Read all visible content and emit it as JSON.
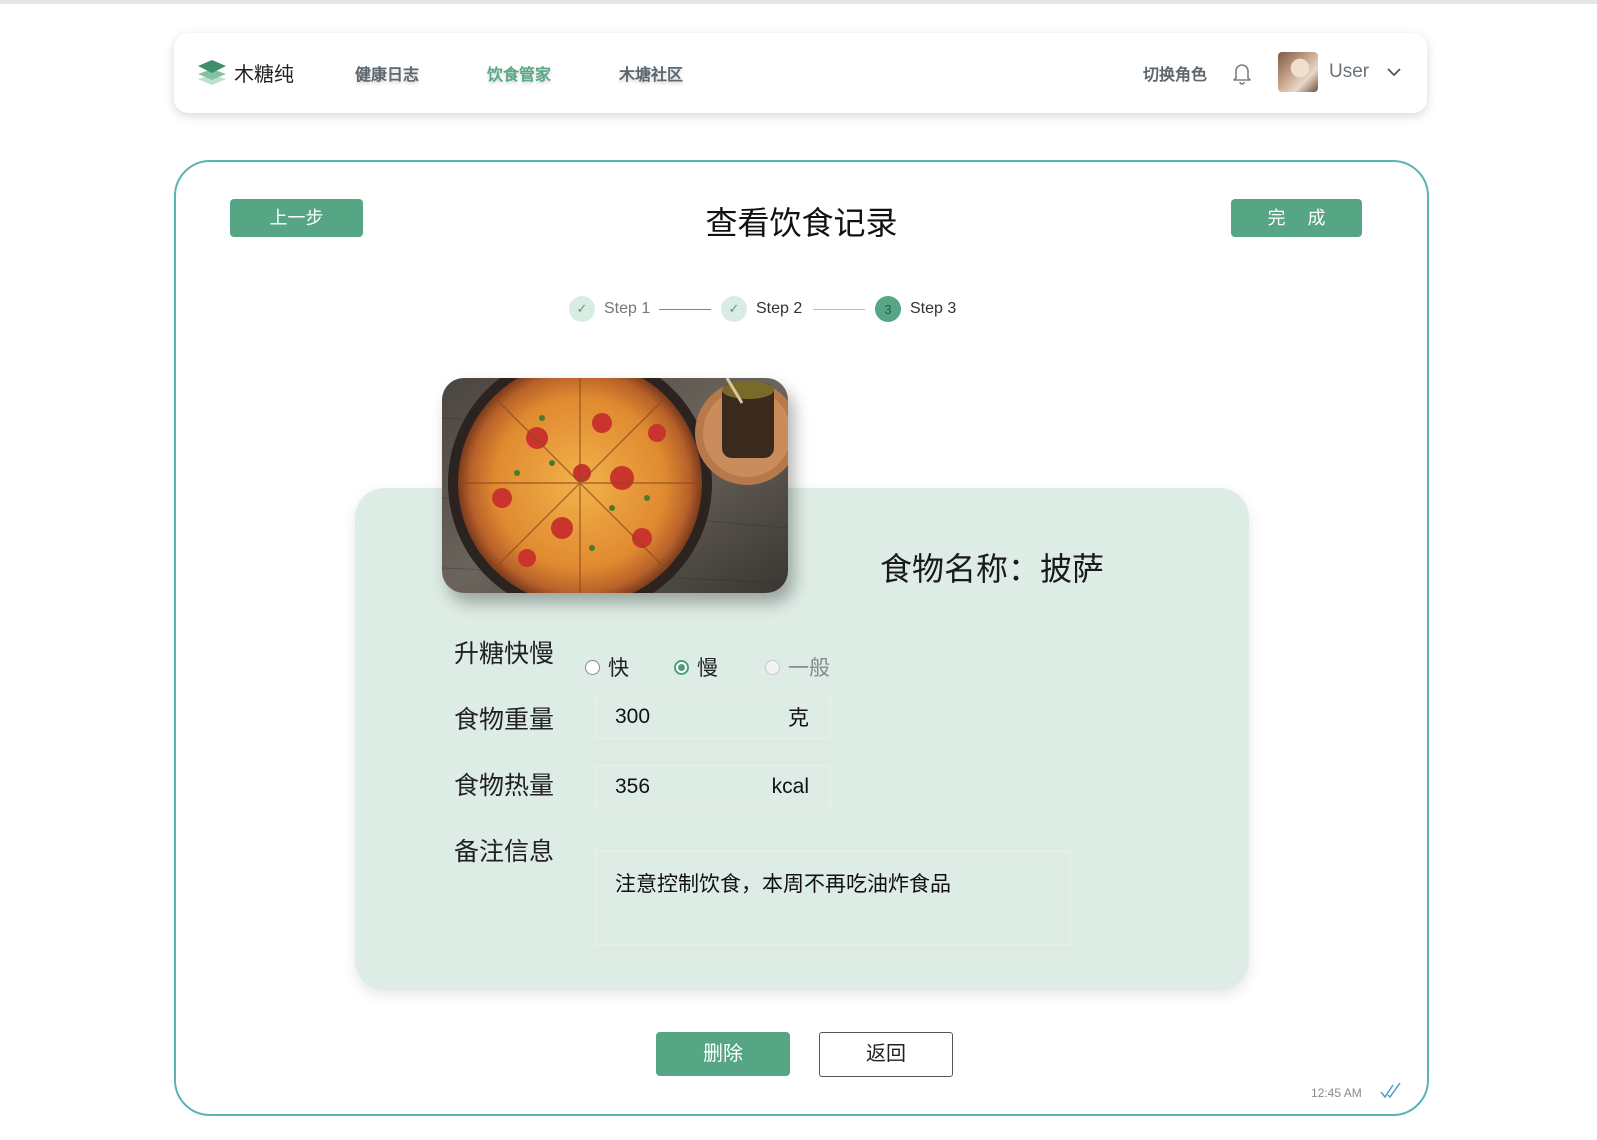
{
  "nav": {
    "logo_text": "木糖纯",
    "links": [
      {
        "label": "健康日志",
        "active": false
      },
      {
        "label": "饮食管家",
        "active": true
      },
      {
        "label": "木塘社区",
        "active": false
      }
    ],
    "switch_role": "切换角色",
    "user_name": "User"
  },
  "page": {
    "title": "查看饮食记录",
    "prev_label": "上一步",
    "done_label": "完成"
  },
  "steps": [
    {
      "label": "Step 1",
      "status": "done",
      "mark": "✓"
    },
    {
      "label": "Step 2",
      "status": "done",
      "mark": "✓"
    },
    {
      "label": "Step 3",
      "status": "current",
      "mark": "3"
    }
  ],
  "food": {
    "title": "食物名称：披萨",
    "image_icon": "pizza-photo"
  },
  "form": {
    "glycemic_label": "升糖快慢",
    "glycemic_options": [
      {
        "label": "快",
        "state": "unchecked"
      },
      {
        "label": "慢",
        "state": "checked"
      },
      {
        "label": "一般",
        "state": "disabled"
      }
    ],
    "weight_label": "食物重量",
    "weight_value": "300",
    "weight_unit": "克",
    "calorie_label": "食物热量",
    "calorie_value": "356",
    "calorie_unit": "kcal",
    "notes_label": "备注信息",
    "notes_value": "注意控制饮食，本周不再吃油炸食品"
  },
  "actions": {
    "delete_label": "删除",
    "back_label": "返回"
  },
  "status": {
    "time": "12:45 AM",
    "read_icon": "double-check-icon"
  },
  "colors": {
    "accent": "#56a685",
    "frame_border": "#5ab3b4",
    "card_bg": "#ddece5",
    "nav_active": "#5aa888"
  }
}
